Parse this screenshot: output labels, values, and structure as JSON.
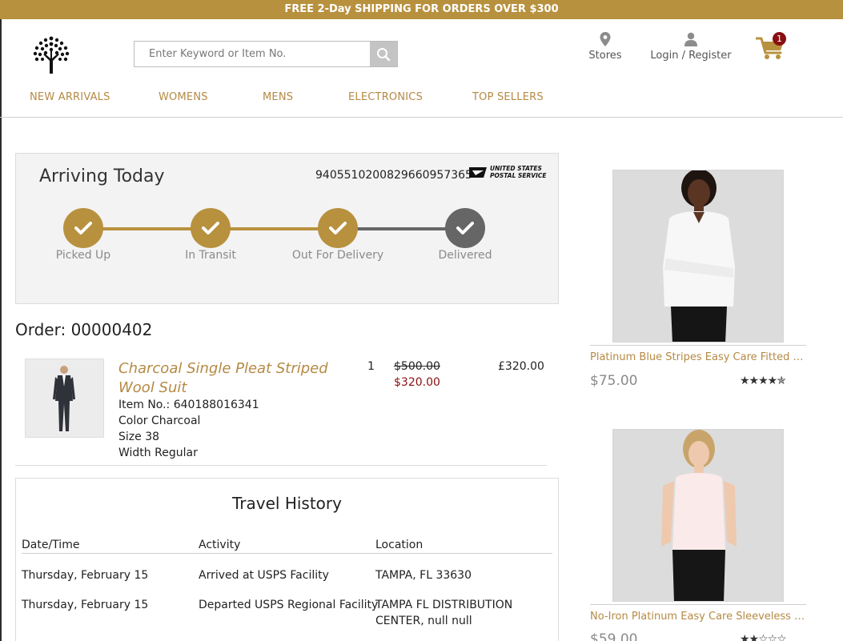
{
  "promo": "FREE 2-Day SHIPPING FOR ORDERS OVER $300",
  "search": {
    "placeholder": "Enter Keyword or Item No."
  },
  "header": {
    "stores": "Stores",
    "login": "Login / Register",
    "cart_count": "1"
  },
  "nav": [
    "NEW ARRIVALS",
    "WOMENS",
    "MENS",
    "ELECTRONICS",
    "TOP SELLERS"
  ],
  "tracking": {
    "title": "Arriving Today",
    "number": "9405510200829660957365",
    "carrier_line1": "UNITED STATES",
    "carrier_line2": "POSTAL SERVICE",
    "steps": [
      "Picked Up",
      "In Transit",
      "Out For Delivery",
      "Delivered"
    ],
    "colors": {
      "done": "#b8913f",
      "pending": "#666666"
    }
  },
  "order": {
    "title": "Order: 00000402",
    "item": {
      "name": "Charcoal Single Pleat Striped Wool Suit",
      "item_no": "Item No.: 640188016341",
      "color": "Color Charcoal",
      "size": "Size 38",
      "width": "Width Regular",
      "qty": "1",
      "was_price": "$500.00",
      "sale_price": "$320.00",
      "total": "£320.00"
    }
  },
  "history": {
    "title": "Travel History",
    "headers": [
      "Date/Time",
      "Activity",
      "Location"
    ],
    "rows": [
      {
        "date": "Thursday, February 15",
        "activity": "Arrived at USPS Facility",
        "location": "TAMPA, FL 33630"
      },
      {
        "date": "Thursday, February 15",
        "activity": "Departed USPS Regional Facility",
        "location": "TAMPA FL DISTRIBUTION CENTER, null null"
      }
    ]
  },
  "recommendations": [
    {
      "name": "Platinum Blue Stripes Easy Care Fitted Shirt",
      "price": "$75.00",
      "stars": "★★★★✯"
    },
    {
      "name": "No-Iron Platinum Easy Care Sleeveless Fitt...",
      "price": "$59.00",
      "stars": "★★☆☆☆"
    }
  ]
}
